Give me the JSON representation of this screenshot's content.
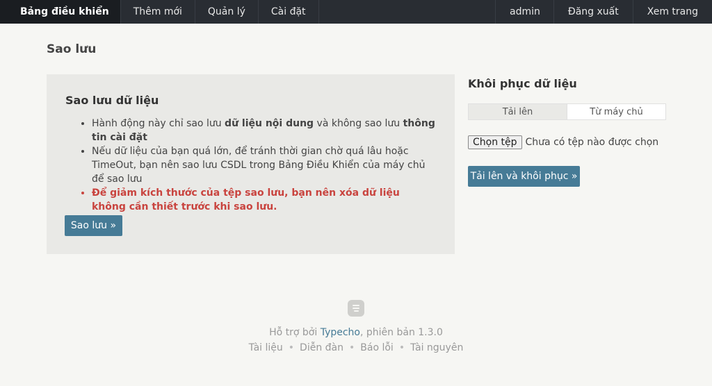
{
  "nav": {
    "left": [
      "Bảng điều khiển",
      "Thêm mới",
      "Quản lý",
      "Cài đặt"
    ],
    "right": [
      "admin",
      "Đăng xuất",
      "Xem trang"
    ]
  },
  "page": {
    "title": "Sao lưu"
  },
  "backup": {
    "heading": "Sao lưu dữ liệu",
    "item1": {
      "pre": "Hành động này chỉ sao lưu ",
      "bold1": "dữ liệu nội dung",
      "mid": " và không sao lưu ",
      "bold2": "thông tin cài đặt"
    },
    "item2": "Nếu dữ liệu của bạn quá lớn, để tránh thời gian chờ quá lâu hoặc TimeOut, bạn nên sao lưu CSDL trong Bảng Điều Khiển của máy chủ để sao lưu",
    "item3": "Để giảm kích thước của tệp sao lưu, bạn nên xóa dữ liệu không cần thiết trước khi sao lưu.",
    "button": "Sao lưu »"
  },
  "restore": {
    "heading": "Khôi phục dữ liệu",
    "tabs": [
      "Tải lên",
      "Từ máy chủ"
    ],
    "file_button": "Chọn tệp",
    "file_status": "Chưa có tệp nào được chọn",
    "button": "Tải lên và khôi phục »"
  },
  "footer": {
    "powered_pre": "Hỗ trợ bởi ",
    "powered_link": "Typecho",
    "powered_post": ", phiên bản 1.3.0",
    "links": [
      "Tài liệu",
      "Diễn đàn",
      "Báo lỗi",
      "Tài nguyên"
    ]
  },
  "colors": {
    "topbar": "#292d33",
    "accent": "#467b96",
    "warning": "#c9443f",
    "panel": "#e9e9e6"
  }
}
